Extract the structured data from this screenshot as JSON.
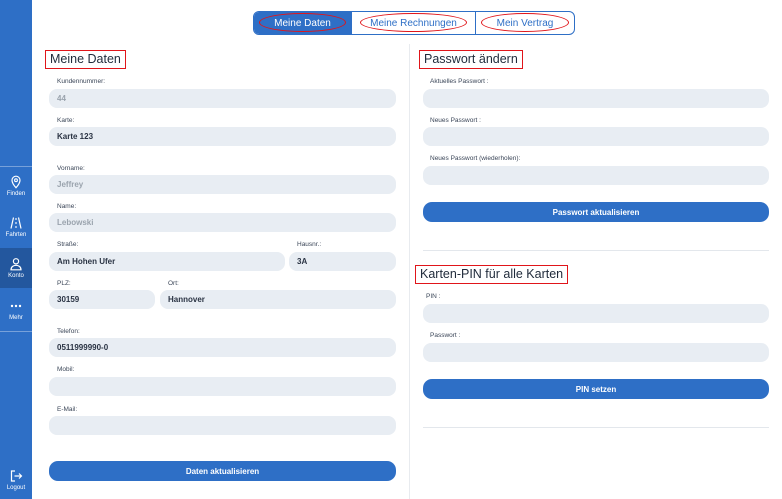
{
  "sidebar": {
    "items": [
      {
        "label": "Finden",
        "icon": "map-pin-icon"
      },
      {
        "label": "Fahrten",
        "icon": "road-icon"
      },
      {
        "label": "Konto",
        "icon": "user-icon"
      },
      {
        "label": "Mehr",
        "icon": "more-dots-icon"
      }
    ],
    "logout_label": "Logout"
  },
  "tabs": [
    {
      "label": "Meine Daten",
      "active": true
    },
    {
      "label": "Meine Rechnungen",
      "active": false
    },
    {
      "label": "Mein Vertrag",
      "active": false
    }
  ],
  "meine_daten": {
    "title": "Meine Daten",
    "kundennummer": {
      "label": "Kundennummer:",
      "value": "44"
    },
    "karte": {
      "label": "Karte:",
      "value": "Karte 123"
    },
    "vorname": {
      "label": "Vorname:",
      "value": "Jeffrey"
    },
    "name": {
      "label": "Name:",
      "value": "Lebowski"
    },
    "strasse": {
      "label": "Straße:",
      "value": "Am Hohen Ufer"
    },
    "hausnr": {
      "label": "Hausnr.:",
      "value": "3A"
    },
    "plz": {
      "label": "PLZ:",
      "value": "30159"
    },
    "ort": {
      "label": "Ort:",
      "value": "Hannover"
    },
    "telefon": {
      "label": "Telefon:",
      "value": "0511999990-0"
    },
    "mobil": {
      "label": "Mobil:",
      "value": ""
    },
    "email": {
      "label": "E-Mail:",
      "value": ""
    },
    "submit_label": "Daten aktualisieren"
  },
  "passwort": {
    "title": "Passwort ändern",
    "aktuelles": {
      "label": "Aktuelles Passwort :",
      "value": ""
    },
    "neues": {
      "label": "Neues Passwort :",
      "value": ""
    },
    "wiederholen": {
      "label": "Neues Passwort (wiederholen):",
      "value": ""
    },
    "submit_label": "Passwort aktualisieren"
  },
  "pin": {
    "title": "Karten-PIN für alle Karten",
    "pin": {
      "label": "PIN :",
      "value": ""
    },
    "passwort": {
      "label": "Passwort :",
      "value": ""
    },
    "submit_label": "PIN setzen"
  },
  "colors": {
    "primary": "#2e6fc6",
    "sidebar_active": "#23579e",
    "field_bg": "#e8edf3",
    "annotation": "#e0151a"
  }
}
